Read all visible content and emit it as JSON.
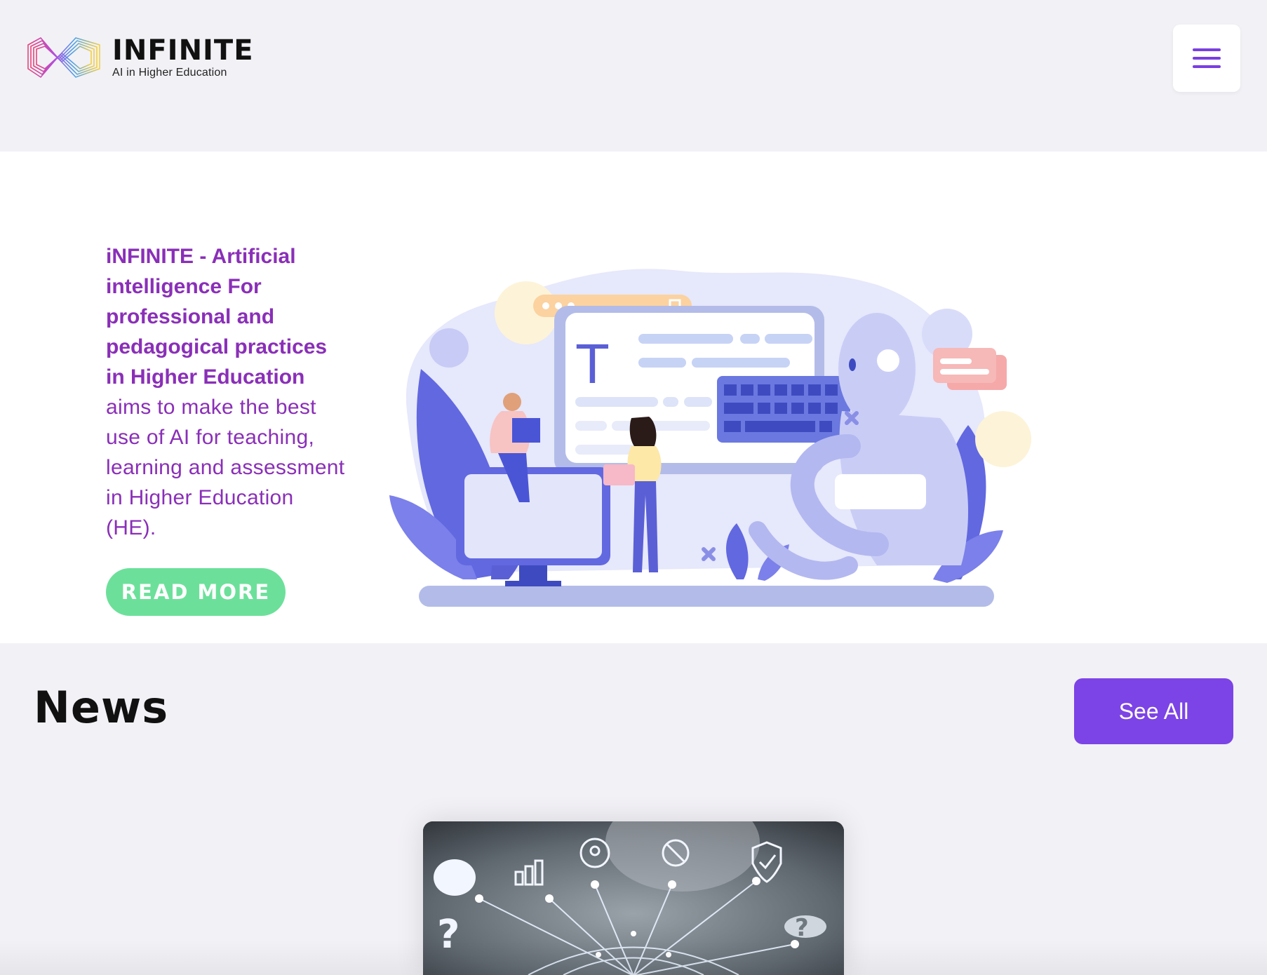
{
  "header": {
    "logo_title": "INFINITE",
    "logo_subtitle": "AI in Higher Education",
    "menu_icon": "hamburger-menu-icon"
  },
  "hero": {
    "headline": "iNFINITE - Artificial intelligence For professional and pedagogical practices in Higher Education",
    "description": "aims to make the best use of AI for teaching, learning and assessment in Higher Education (HE).",
    "cta_label": "READ MORE",
    "illustration": "ai-education-illustration",
    "illustration_letter": "T"
  },
  "news": {
    "title": "News",
    "see_all_label": "See All",
    "card_image": "ai-network-icons-image"
  },
  "colors": {
    "brand_purple": "#8a2fb8",
    "button_purple": "#7c44e6",
    "cta_green": "#6ce09a",
    "page_bg": "#f2f1f6",
    "illustration_blue": "#6268e0"
  }
}
